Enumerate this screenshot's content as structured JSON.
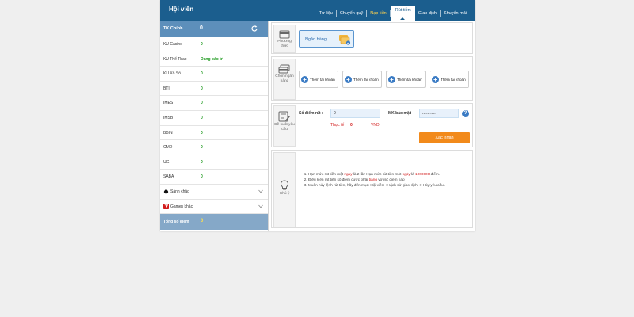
{
  "header": {
    "title": "Hội viên",
    "nav": [
      "Tư liệu",
      "Chuyển quỹ",
      "Nạp tiền",
      "Rút tiền",
      "Giao dịch",
      "Khuyến mãi"
    ],
    "active_nav_index": 3
  },
  "sidebar": {
    "main": {
      "label": "TK Chính",
      "value": "0"
    },
    "rows": [
      {
        "name": "KU Casino",
        "value": "0"
      },
      {
        "name": "KU Thể Thao",
        "value": "Đang bảo trì"
      },
      {
        "name": "KU Xổ Số",
        "value": "0"
      },
      {
        "name": "BTI",
        "value": "0"
      },
      {
        "name": "IMES",
        "value": "0"
      },
      {
        "name": "IMSB",
        "value": "0"
      },
      {
        "name": "BBIN",
        "value": "0"
      },
      {
        "name": "CMD",
        "value": "0"
      },
      {
        "name": "UG",
        "value": "0"
      },
      {
        "name": "SABA",
        "value": "0"
      }
    ],
    "other_halls": "Sảnh khác",
    "other_games": "Games khác",
    "total": {
      "label": "Tổng số điểm",
      "value": "0"
    }
  },
  "method": {
    "label": "Phương thức",
    "option": "Ngân hàng"
  },
  "bank": {
    "label": "Chọn ngân hàng",
    "buttons": [
      "Thêm tài khoản",
      "Thêm tài khoản",
      "Thêm tài khoản",
      "Thêm tài khoản"
    ]
  },
  "request": {
    "label": "Đề xuất yêu cầu",
    "points_label": "Số điểm rút :",
    "points_value": "0",
    "password_label": "MK bảo mật",
    "password_value": "••••••••••",
    "actual_label": "Thực tế :",
    "actual_value": "0",
    "currency": "VND",
    "submit": "Xác nhận"
  },
  "notes": {
    "label": "Chú ý",
    "items": [
      {
        "parts": [
          "Hạn mức rút tiền một ",
          "ngày",
          " là 2 lần Hạn mức rút tiền một ",
          "ngày",
          " là ",
          "1000000",
          " điểm."
        ]
      },
      {
        "parts": [
          "Điều kiện rút tiền số điểm cược phải ",
          "bằng",
          " với số điểm nạp"
        ]
      },
      {
        "parts": [
          "Muốn hủy lệnh rút tiền, hãy đến mục: Hội viên -> Lịch sử giao dịch -> Hủy yêu cầu."
        ]
      }
    ]
  },
  "colors": {
    "header_bg": "#1b5e8e",
    "sidebar_head": "#5d8fbb",
    "positive": "#1e9a1e",
    "accent_orange": "#f28a1b",
    "warning_red": "#d21c1c",
    "total_value": "#ffe04a"
  }
}
